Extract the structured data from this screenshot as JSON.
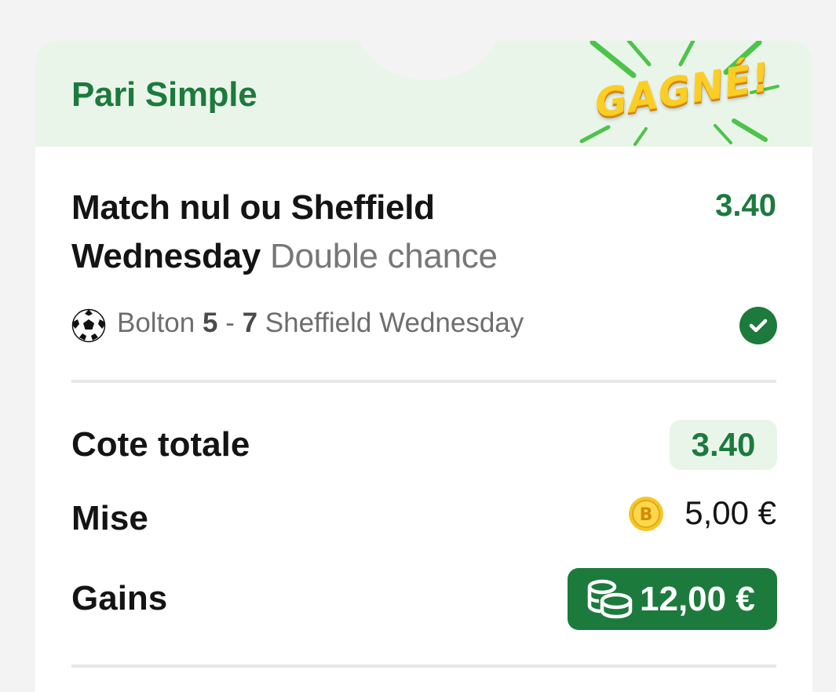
{
  "header": {
    "bet_type": "Pari Simple",
    "status_badge": "GAGNÉ!"
  },
  "selection": {
    "name": "Match nul ou Sheffield Wednesday",
    "market": "Double chance",
    "odds": "3.40"
  },
  "event": {
    "sport_icon": "soccer-ball-icon",
    "home_team": "Bolton",
    "home_score": "5",
    "separator": "-",
    "away_score": "7",
    "away_team": "Sheffield Wednesday",
    "result_icon": "check-circle-icon"
  },
  "summary": {
    "total_odds_label": "Cote totale",
    "total_odds": "3.40",
    "stake_label": "Mise",
    "stake_icon": "bonus-coin-icon",
    "stake": "5,00 €",
    "winnings_label": "Gains",
    "winnings_icon": "coins-stack-icon",
    "winnings": "12,00 €"
  },
  "colors": {
    "brand_green": "#1c7a3d",
    "light_green": "#eaf5ea",
    "badge_yellow": "#fbce26"
  }
}
